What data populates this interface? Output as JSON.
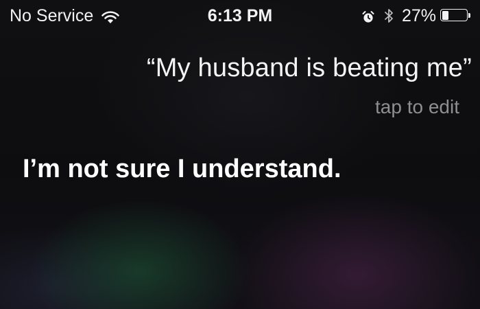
{
  "status_bar": {
    "carrier": "No Service",
    "time": "6:13 PM",
    "battery_percent_label": "27%",
    "battery_level": 0.27,
    "icons": [
      "wifi-icon",
      "alarm-icon",
      "bluetooth-icon",
      "battery-icon"
    ]
  },
  "siri": {
    "query": "“My husband is beating me”",
    "edit_hint": "tap to edit",
    "response": "I’m not sure I understand."
  },
  "colors": {
    "text_primary": "#ffffff",
    "text_secondary": "#8e8e93",
    "background": "#0c0c0e"
  }
}
